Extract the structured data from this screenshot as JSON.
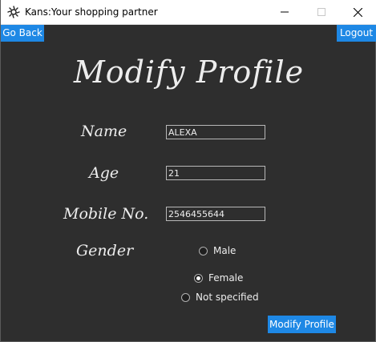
{
  "window": {
    "title": "Kans:Your shopping partner"
  },
  "nav": {
    "go_back_label": "Go Back",
    "logout_label": "Logout"
  },
  "form": {
    "heading": "Modify Profile",
    "name_label": "Name",
    "name_value": "ALEXA",
    "age_label": "Age",
    "age_value": "21",
    "mobile_label": "Mobile No.",
    "mobile_value": "2546455644",
    "gender_label": "Gender",
    "gender_options": [
      {
        "label": "Male",
        "selected": false
      },
      {
        "label": "Female",
        "selected": true
      },
      {
        "label": "Not specified",
        "selected": false
      }
    ],
    "submit_label": "Modify Profile"
  },
  "colors": {
    "background": "#2e2e2e",
    "accent": "#1e88e5",
    "text": "#ededed"
  },
  "icons": {
    "app": "app-logo-icon",
    "minimize": "minimize-icon",
    "maximize": "maximize-icon",
    "close": "close-icon"
  }
}
